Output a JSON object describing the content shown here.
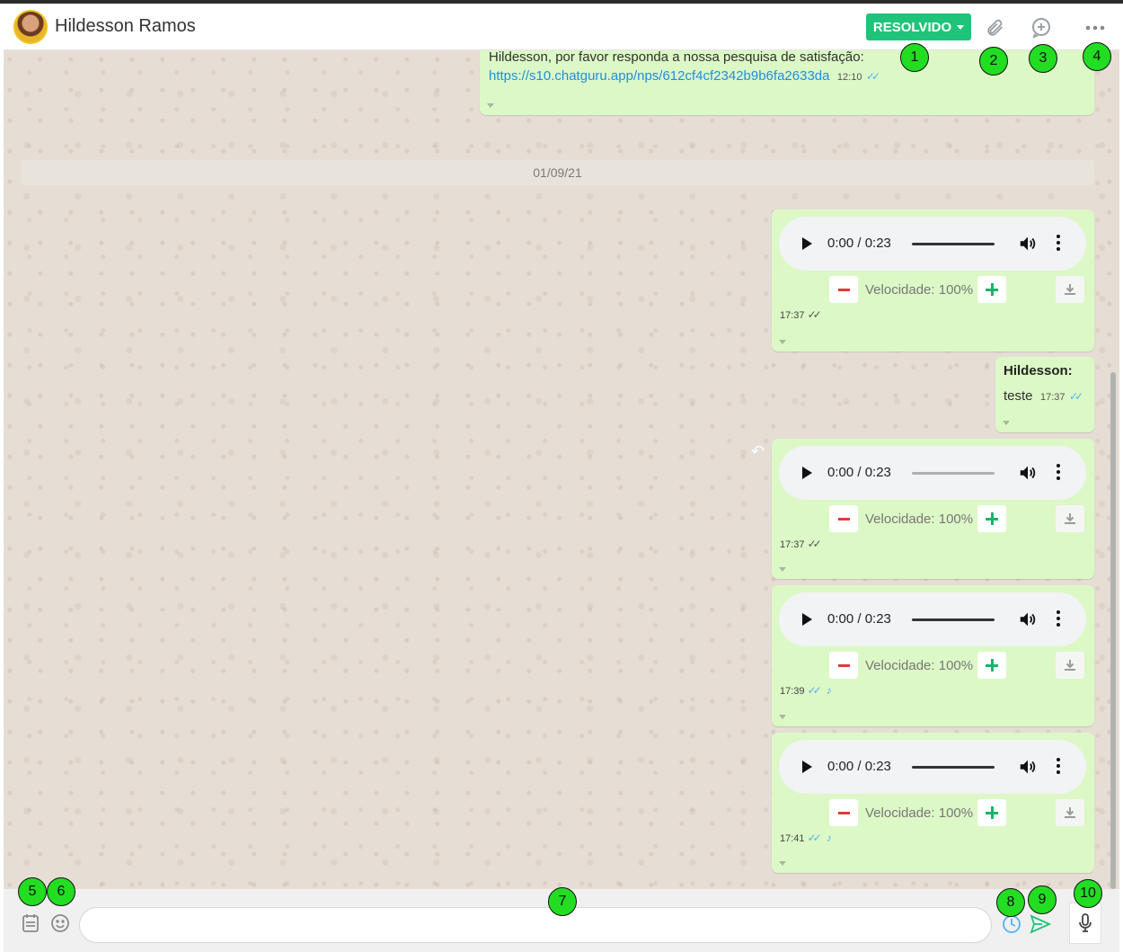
{
  "header": {
    "contact_name": "Hildesson Ramos",
    "status_button": "RESOLVIDO"
  },
  "messages": {
    "nps": {
      "text": "Hildesson, por favor responda a nossa pesquisa de satisfação:",
      "link": "https://s10.chatguru.app/nps/612cf4cf2342b9b6fa2633da",
      "time": "12:10"
    },
    "date_separator": "01/09/21",
    "audios": [
      {
        "time_display": "0:00 / 0:23",
        "speed": "Velocidade: 100%",
        "sent_time": "17:37",
        "ticks": "read-gray",
        "heard": false
      },
      {
        "time_display": "0:00 / 0:23",
        "speed": "Velocidade: 100%",
        "sent_time": "17:37",
        "ticks": "read-gray",
        "heard": false
      },
      {
        "time_display": "0:00 / 0:23",
        "speed": "Velocidade: 100%",
        "sent_time": "17:39",
        "ticks": "read-blue",
        "heard": true
      },
      {
        "time_display": "0:00 / 0:23",
        "speed": "Velocidade: 100%",
        "sent_time": "17:41",
        "ticks": "read-blue",
        "heard": true
      }
    ],
    "text_msg": {
      "author": "Hildesson:",
      "text": "teste",
      "time": "17:37"
    }
  },
  "composer": {
    "placeholder": ""
  },
  "markers": [
    "1",
    "2",
    "3",
    "4",
    "5",
    "6",
    "7",
    "8",
    "9",
    "10"
  ],
  "icons": [
    "paperclip-icon",
    "new-chat-icon",
    "more-options-icon",
    "notes-icon",
    "emoji-icon",
    "schedule-icon",
    "send-icon",
    "microphone-icon",
    "download-icon",
    "volume-icon",
    "reply-icon"
  ],
  "colors": {
    "accent_green": "#1fc47a",
    "bubble": "#dcf8c6",
    "marker_green": "#22dd22",
    "read_blue": "#4fb3f6"
  }
}
